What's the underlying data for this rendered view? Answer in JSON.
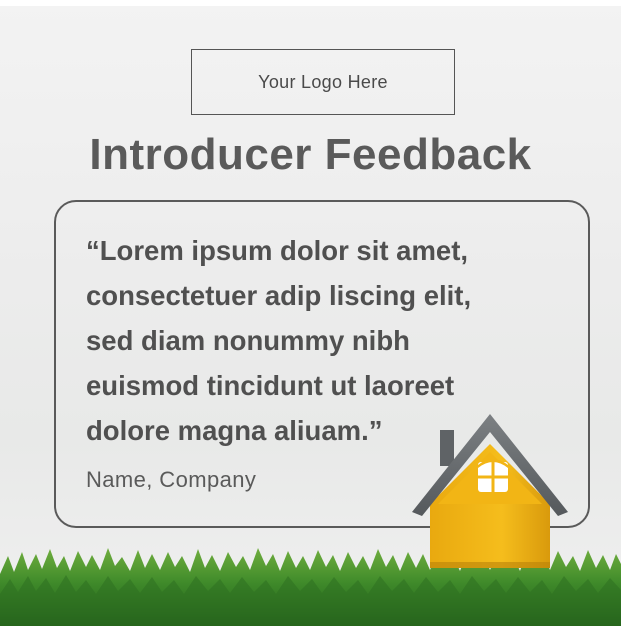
{
  "logo": {
    "label": "Your Logo Here"
  },
  "header": {
    "title": "Introducer Feedback"
  },
  "testimonial": {
    "quote": "“Lorem ipsum dolor sit amet,\nconsectetuer adip liscing elit,\nsed diam nonummy nibh\neuismod tincidunt ut laoreet\ndolore magna aliuam.”",
    "attribution": "Name, Company"
  },
  "colors": {
    "text_dark": "#505050",
    "border": "#5a5a5a",
    "house_wall": "#f2b515",
    "house_roof": "#6b6f72",
    "grass": "#3f8a2a"
  },
  "icons": [
    "house-icon",
    "grass-decoration"
  ]
}
